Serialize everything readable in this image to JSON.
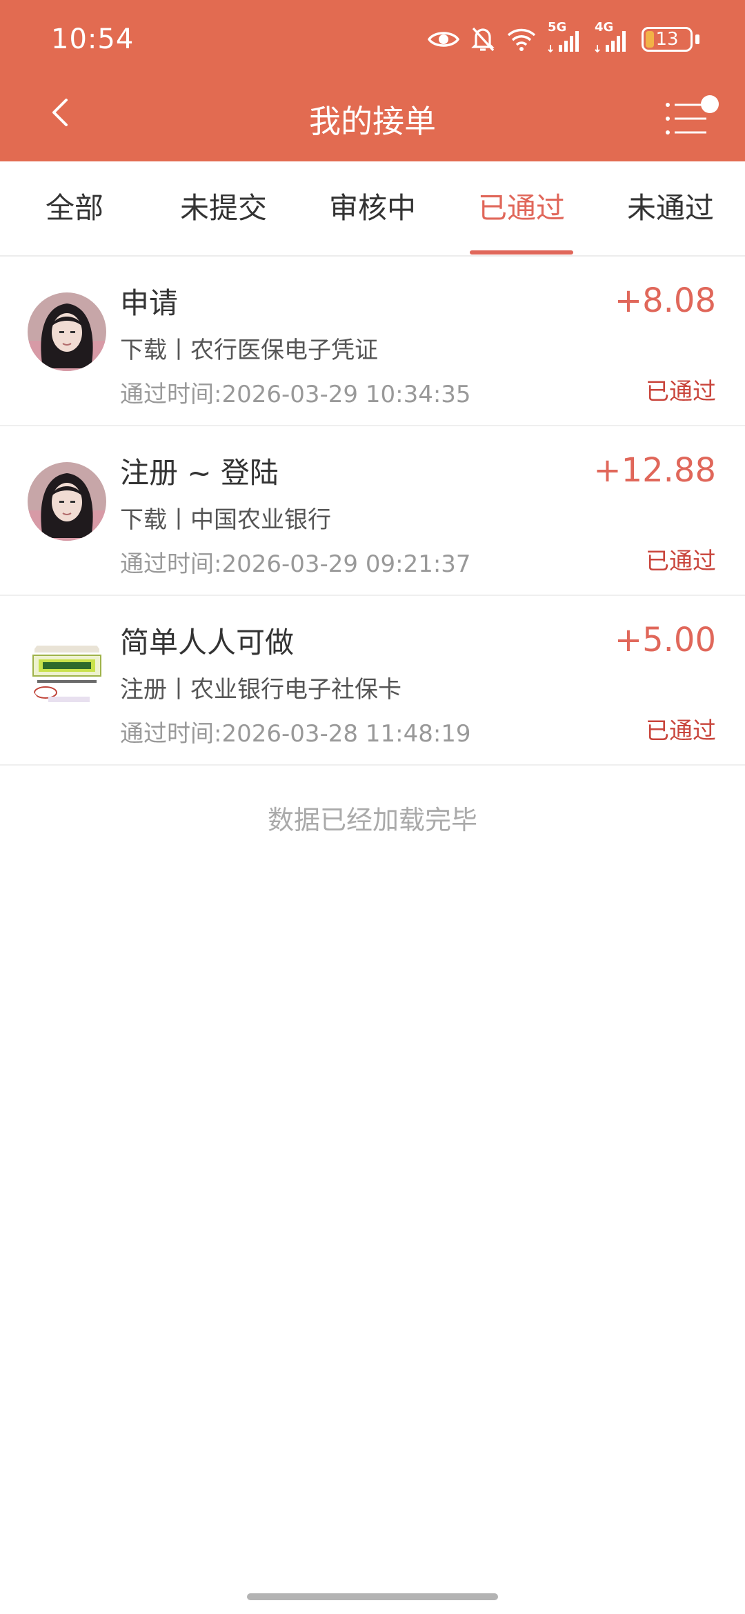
{
  "status_bar": {
    "time": "10:54",
    "net5g": "5G",
    "net4g": "4G",
    "battery": "13",
    "icons": [
      "eye-icon",
      "bell-muted-icon",
      "wifi-icon",
      "signal-5g-icon",
      "signal-4g-icon",
      "battery-icon"
    ]
  },
  "header": {
    "title": "我的接单",
    "back_icon": "chevron-left-icon",
    "menu_icon": "list-menu-icon"
  },
  "tabs": [
    {
      "label": "全部"
    },
    {
      "label": "未提交"
    },
    {
      "label": "审核中"
    },
    {
      "label": "已通过",
      "active": true
    },
    {
      "label": "未通过"
    }
  ],
  "orders": [
    {
      "title": "申请",
      "subtitle": "下载丨农行医保电子凭证",
      "time": "通过时间:2026-03-29 10:34:35",
      "amount": "+8.08",
      "status": "已通过"
    },
    {
      "title": "注册 ~ 登陆",
      "subtitle": "下载丨中国农业银行",
      "time": "通过时间:2026-03-29 09:21:37",
      "amount": "+12.88",
      "status": "已通过"
    },
    {
      "title": "简单人人可做",
      "subtitle": "注册丨农业银行电子社保卡",
      "time": "通过时间:2026-03-28 11:48:19",
      "amount": "+5.00",
      "status": "已通过"
    }
  ],
  "footer_text": "数据已经加载完毕",
  "colors": {
    "header_bg": "#E26B51",
    "accent": "#E0675A",
    "status_text": "#C9453C"
  }
}
